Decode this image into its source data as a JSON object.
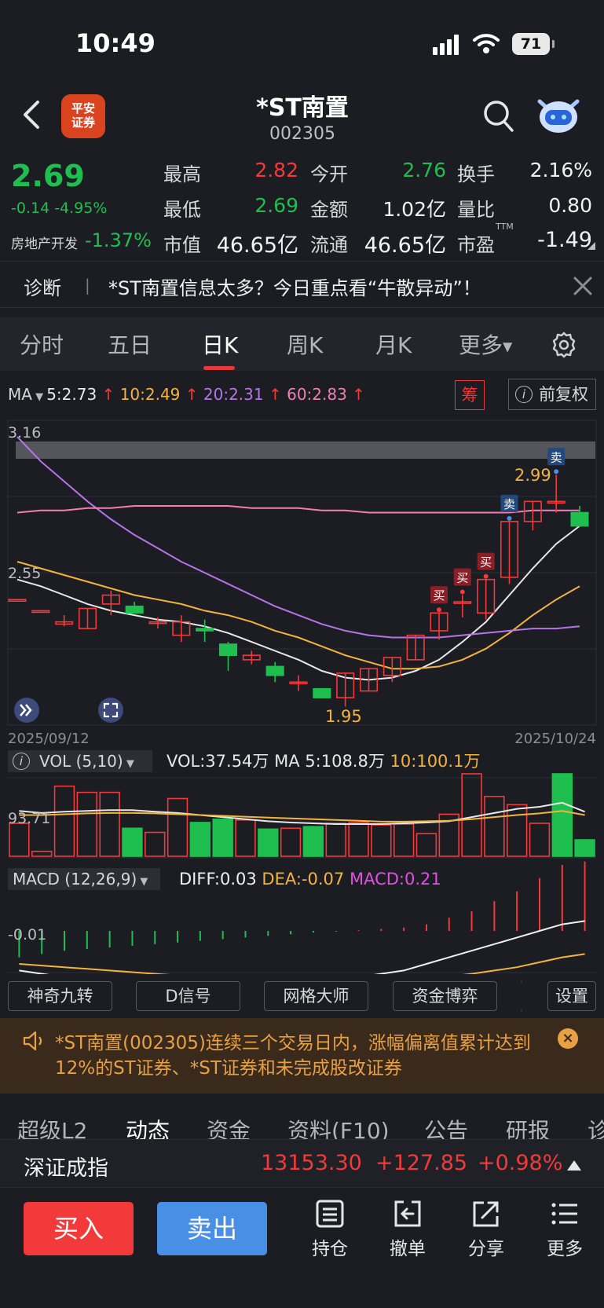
{
  "status_bar": {
    "time": "10:49",
    "battery": "71"
  },
  "header": {
    "logo_line1": "平安",
    "logo_line2": "证券",
    "title": "*ST南置",
    "code": "002305"
  },
  "quote": {
    "price": "2.69",
    "change": "-0.14  -4.95%",
    "sector_name": "房地产开发",
    "sector_change": "-1.37%",
    "rows": [
      [
        {
          "label": "最高",
          "value": "2.82"
        },
        {
          "label": "今开",
          "value": "2.76"
        },
        {
          "label": "换手",
          "value": "2.16%"
        }
      ],
      [
        {
          "label": "最低",
          "value": "2.69"
        },
        {
          "label": "金额",
          "value": "1.02亿"
        },
        {
          "label": "量比",
          "value": "0.80"
        }
      ],
      [
        {
          "label": "市值",
          "value": "46.65亿"
        },
        {
          "label": "流通",
          "value": "46.65亿"
        },
        {
          "label": "市盈",
          "value": "-1.49",
          "sup": "TTM"
        }
      ]
    ]
  },
  "diagnosis": {
    "label": "诊断",
    "separator": "|",
    "text": "*ST南置信息太多？今日重点看“牛散异动”！"
  },
  "chart_tabs": [
    "分时",
    "五日",
    "日K",
    "周K",
    "月K",
    "更多"
  ],
  "ma_row": {
    "label": "MA",
    "ma5": "5:2.73",
    "ma10": "10:2.49",
    "ma20": "20:2.31",
    "ma60": "60:2.83",
    "chou_button": "筹",
    "fuquan_button": "前复权",
    "colors": {
      "ma5": "#e8e8e8",
      "ma10": "#f4b43c",
      "ma20": "#b674e8",
      "ma60": "#ef7fb4",
      "up": "#f23a3a",
      "down": "#1fbf4f"
    }
  },
  "chart_data": [
    {
      "type": "candlestick",
      "x_start": "2025/09/12",
      "x_end": "2025/10/24",
      "y_tick_labels": [
        "3.16",
        "2.55"
      ],
      "ylim": [
        1.86,
        3.16
      ],
      "high_annotation": "2.99",
      "low_annotation": "1.95",
      "signal_labels": {
        "buy": "买",
        "sell": "卖"
      },
      "candles": [
        {
          "o": 2.43,
          "h": 2.43,
          "l": 2.43,
          "c": 2.43
        },
        {
          "o": 2.38,
          "h": 2.38,
          "l": 2.38,
          "c": 2.38
        },
        {
          "o": 2.32,
          "h": 2.36,
          "l": 2.31,
          "c": 2.33
        },
        {
          "o": 2.3,
          "h": 2.39,
          "l": 2.3,
          "c": 2.39
        },
        {
          "o": 2.41,
          "h": 2.47,
          "l": 2.36,
          "c": 2.45
        },
        {
          "o": 2.4,
          "h": 2.42,
          "l": 2.37,
          "c": 2.37
        },
        {
          "o": 2.33,
          "h": 2.35,
          "l": 2.3,
          "c": 2.33
        },
        {
          "o": 2.27,
          "h": 2.36,
          "l": 2.24,
          "c": 2.33
        },
        {
          "o": 2.3,
          "h": 2.34,
          "l": 2.24,
          "c": 2.29
        },
        {
          "o": 2.23,
          "h": 2.24,
          "l": 2.11,
          "c": 2.18
        },
        {
          "o": 2.16,
          "h": 2.2,
          "l": 2.14,
          "c": 2.18
        },
        {
          "o": 2.13,
          "h": 2.15,
          "l": 2.06,
          "c": 2.09
        },
        {
          "o": 2.06,
          "h": 2.09,
          "l": 2.02,
          "c": 2.06
        },
        {
          "o": 2.03,
          "h": 2.03,
          "l": 1.99,
          "c": 1.99
        },
        {
          "o": 1.99,
          "h": 2.1,
          "l": 1.95,
          "c": 2.1
        },
        {
          "o": 2.02,
          "h": 2.12,
          "l": 2.02,
          "c": 2.12
        },
        {
          "o": 2.09,
          "h": 2.17,
          "l": 2.06,
          "c": 2.17
        },
        {
          "o": 2.16,
          "h": 2.27,
          "l": 2.16,
          "c": 2.27
        },
        {
          "o": 2.29,
          "h": 2.37,
          "l": 2.25,
          "c": 2.37
        },
        {
          "o": 2.42,
          "h": 2.45,
          "l": 2.35,
          "c": 2.42
        },
        {
          "o": 2.37,
          "h": 2.52,
          "l": 2.34,
          "c": 2.52
        },
        {
          "o": 2.53,
          "h": 2.78,
          "l": 2.5,
          "c": 2.78
        },
        {
          "o": 2.78,
          "h": 2.87,
          "l": 2.74,
          "c": 2.87
        },
        {
          "o": 2.87,
          "h": 2.99,
          "l": 2.82,
          "c": 2.87
        },
        {
          "o": 2.82,
          "h": 2.85,
          "l": 2.76,
          "c": 2.76
        }
      ],
      "signals": [
        {
          "index": 18,
          "type": "buy"
        },
        {
          "index": 19,
          "type": "buy"
        },
        {
          "index": 20,
          "type": "buy"
        },
        {
          "index": 21,
          "type": "sell"
        },
        {
          "index": 23,
          "type": "sell"
        }
      ],
      "series": [
        {
          "name": "MA5",
          "values": [
            2.52,
            2.49,
            2.45,
            2.41,
            2.38,
            2.36,
            2.34,
            2.33,
            2.31,
            2.28,
            2.24,
            2.2,
            2.16,
            2.11,
            2.08,
            2.07,
            2.08,
            2.11,
            2.16,
            2.24,
            2.33,
            2.45,
            2.57,
            2.68,
            2.76
          ]
        },
        {
          "name": "MA10",
          "values": [
            2.6,
            2.57,
            2.54,
            2.51,
            2.48,
            2.45,
            2.43,
            2.41,
            2.38,
            2.36,
            2.33,
            2.29,
            2.26,
            2.22,
            2.18,
            2.15,
            2.12,
            2.12,
            2.13,
            2.16,
            2.21,
            2.28,
            2.36,
            2.43,
            2.49
          ]
        },
        {
          "name": "MA20",
          "values": [
            3.16,
            3.05,
            2.96,
            2.87,
            2.79,
            2.72,
            2.66,
            2.6,
            2.55,
            2.5,
            2.45,
            2.4,
            2.36,
            2.32,
            2.29,
            2.27,
            2.26,
            2.26,
            2.26,
            2.27,
            2.28,
            2.29,
            2.3,
            2.3,
            2.31
          ]
        },
        {
          "name": "MA60",
          "values": [
            2.82,
            2.83,
            2.83,
            2.84,
            2.84,
            2.85,
            2.85,
            2.85,
            2.85,
            2.85,
            2.84,
            2.84,
            2.84,
            2.83,
            2.83,
            2.82,
            2.82,
            2.82,
            2.82,
            2.82,
            2.82,
            2.82,
            2.83,
            2.83,
            2.83
          ]
        }
      ]
    },
    {
      "type": "bar",
      "title": "VOL (5,10)",
      "y_tick_label": "93.71",
      "values": [
        80,
        12,
        170,
        155,
        155,
        68,
        58,
        140,
        82,
        90,
        88,
        66,
        68,
        72,
        80,
        82,
        76,
        78,
        55,
        102,
        200,
        145,
        125,
        80,
        200,
        40
      ],
      "series": [
        {
          "name": "MA5",
          "values": [
            110,
            105,
            108,
            110,
            112,
            112,
            108,
            105,
            100,
            95,
            90,
            85,
            82,
            80,
            78,
            78,
            78,
            80,
            82,
            85,
            95,
            105,
            115,
            120,
            130,
            108
          ]
        },
        {
          "name": "MA10",
          "values": [
            100,
            100,
            102,
            104,
            105,
            105,
            104,
            102,
            100,
            98,
            96,
            94,
            92,
            90,
            88,
            86,
            84,
            84,
            85,
            86,
            90,
            95,
            100,
            104,
            110,
            100
          ]
        }
      ],
      "values_text": {
        "vol": "VOL:37.54万",
        "ma_label": "MA",
        "ma5": "5:108.8万",
        "ma10": "10:100.1万"
      }
    },
    {
      "type": "bar",
      "title": "MACD (12,26,9)",
      "y_tick_label": "-0.01",
      "values": [
        -0.08,
        -0.07,
        -0.06,
        -0.055,
        -0.05,
        -0.045,
        -0.04,
        -0.035,
        -0.03,
        -0.025,
        -0.02,
        -0.015,
        -0.01,
        -0.005,
        -0.002,
        0.002,
        0.006,
        0.01,
        0.02,
        0.04,
        0.06,
        0.09,
        0.12,
        0.16,
        0.2,
        0.21
      ],
      "series": [
        {
          "name": "DIFF",
          "values": [
            -0.12,
            -0.13,
            -0.14,
            -0.145,
            -0.15,
            -0.155,
            -0.155,
            -0.155,
            -0.155,
            -0.155,
            -0.155,
            -0.155,
            -0.155,
            -0.155,
            -0.15,
            -0.14,
            -0.13,
            -0.12,
            -0.1,
            -0.08,
            -0.06,
            -0.04,
            -0.02,
            0.0,
            0.02,
            0.03
          ]
        },
        {
          "name": "DEA",
          "values": [
            -0.1,
            -0.105,
            -0.11,
            -0.115,
            -0.12,
            -0.125,
            -0.13,
            -0.135,
            -0.14,
            -0.14,
            -0.145,
            -0.145,
            -0.15,
            -0.15,
            -0.15,
            -0.15,
            -0.148,
            -0.146,
            -0.143,
            -0.138,
            -0.13,
            -0.12,
            -0.11,
            -0.095,
            -0.08,
            -0.07
          ]
        }
      ],
      "values_text": {
        "diff": "DIFF:0.03",
        "dea": "DEA:-0.07",
        "macd": "MACD:0.21"
      }
    }
  ],
  "tools": [
    "神奇九转",
    "D信号",
    "网格大师",
    "资金博弈",
    "设置"
  ],
  "alert": {
    "text": "*ST南置(002305)连续三个交易日内，涨幅偏离值累计达到12%的ST证券、*ST证券和未完成股改证券",
    "close": "×"
  },
  "bottom_tabs": [
    "超级L2",
    "动态",
    "资金",
    "资料(F10)",
    "公告",
    "研报",
    "诊"
  ],
  "index_bar": {
    "name": "深证成指",
    "value": "13153.30",
    "change": "+127.85",
    "pct": "+0.98%"
  },
  "actions": {
    "buy": "买入",
    "sell": "卖出",
    "hold": "持仓",
    "cancel": "撤单",
    "share": "分享",
    "more": "更多"
  }
}
